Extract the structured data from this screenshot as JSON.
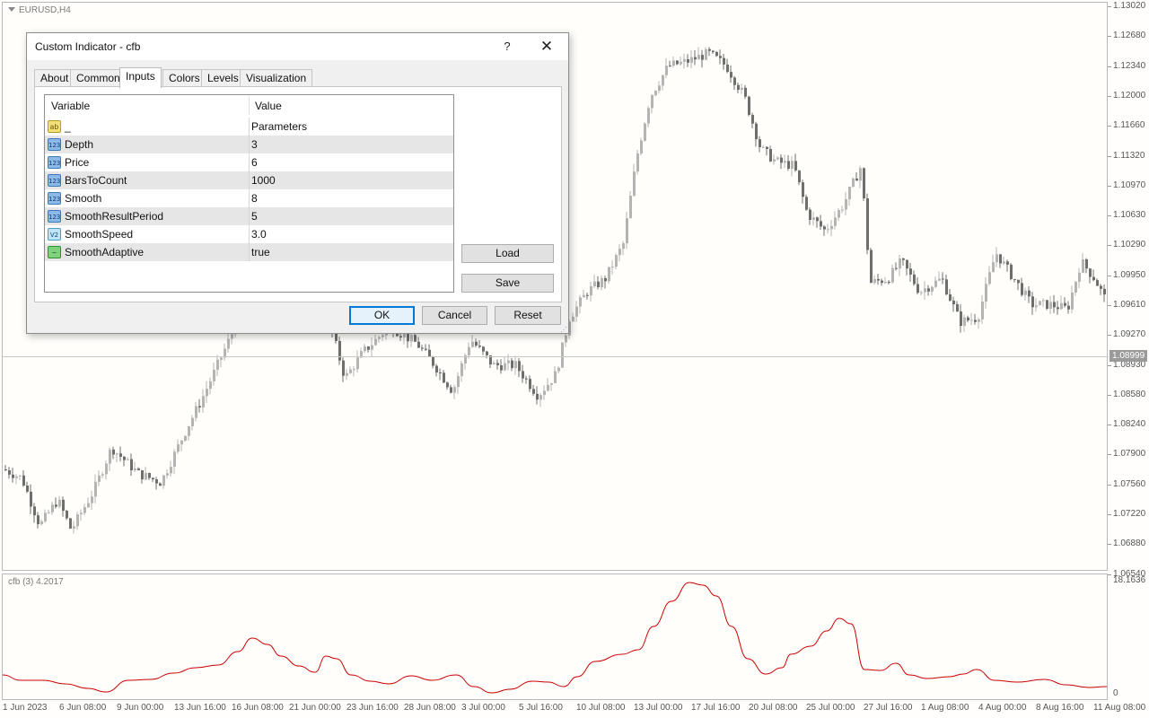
{
  "chart": {
    "symbol_label": "EURUSD,H4",
    "indicator_label": "cfb (3) 4.2017",
    "current_price": "1.08999",
    "price_axis": [
      "1.13020",
      "1.12680",
      "1.12340",
      "1.12000",
      "1.11660",
      "1.11320",
      "1.10970",
      "1.10630",
      "1.10290",
      "1.09950",
      "1.09610",
      "1.09270",
      "1.08930",
      "1.08580",
      "1.08240",
      "1.07900",
      "1.07560",
      "1.07220",
      "1.06880",
      "1.06540"
    ],
    "indicator_axis": [
      "18.1636",
      "0"
    ],
    "time_axis": [
      "1 Jun 2023",
      "6 Jun 08:00",
      "9 Jun 00:00",
      "13 Jun 16:00",
      "16 Jun 08:00",
      "21 Jun 00:00",
      "23 Jun 16:00",
      "28 Jun 08:00",
      "3 Jul 00:00",
      "5 Jul 16:00",
      "10 Jul 08:00",
      "13 Jul 00:00",
      "17 Jul 16:00",
      "20 Jul 08:00",
      "25 Jul 00:00",
      "27 Jul 16:00",
      "1 Aug 08:00",
      "4 Aug 00:00",
      "8 Aug 16:00",
      "11 Aug 08:00"
    ],
    "indicator_color": "#cc0000",
    "bull_color": "#b4b4b4",
    "bear_color": "#6e6e6e"
  },
  "dialog": {
    "title": "Custom Indicator - cfb",
    "help_label": "?",
    "close_label": "✕",
    "tabs": [
      "About",
      "Common",
      "Inputs",
      "Colors",
      "Levels",
      "Visualization"
    ],
    "active_tab": "Inputs",
    "table": {
      "headers": [
        "Variable",
        "Value"
      ],
      "rows": [
        {
          "icon": "string-type-icon",
          "icon_text": "ab",
          "variable": "_",
          "value": "Parameters"
        },
        {
          "icon": "integer-type-icon",
          "icon_text": "123",
          "variable": "Depth",
          "value": "3"
        },
        {
          "icon": "integer-type-icon",
          "icon_text": "123",
          "variable": "Price",
          "value": "6"
        },
        {
          "icon": "integer-type-icon",
          "icon_text": "123",
          "variable": "BarsToCount",
          "value": "1000"
        },
        {
          "icon": "integer-type-icon",
          "icon_text": "123",
          "variable": "Smooth",
          "value": "8"
        },
        {
          "icon": "integer-type-icon",
          "icon_text": "123",
          "variable": "SmoothResultPeriod",
          "value": "5"
        },
        {
          "icon": "double-type-icon",
          "icon_text": "V2",
          "variable": "SmoothSpeed",
          "value": "3.0"
        },
        {
          "icon": "bool-type-icon",
          "icon_text": "~",
          "variable": "SmoothAdaptive",
          "value": "true"
        }
      ]
    },
    "load_label": "Load",
    "save_label": "Save",
    "ok_label": "OK",
    "cancel_label": "Cancel",
    "reset_label": "Reset"
  }
}
